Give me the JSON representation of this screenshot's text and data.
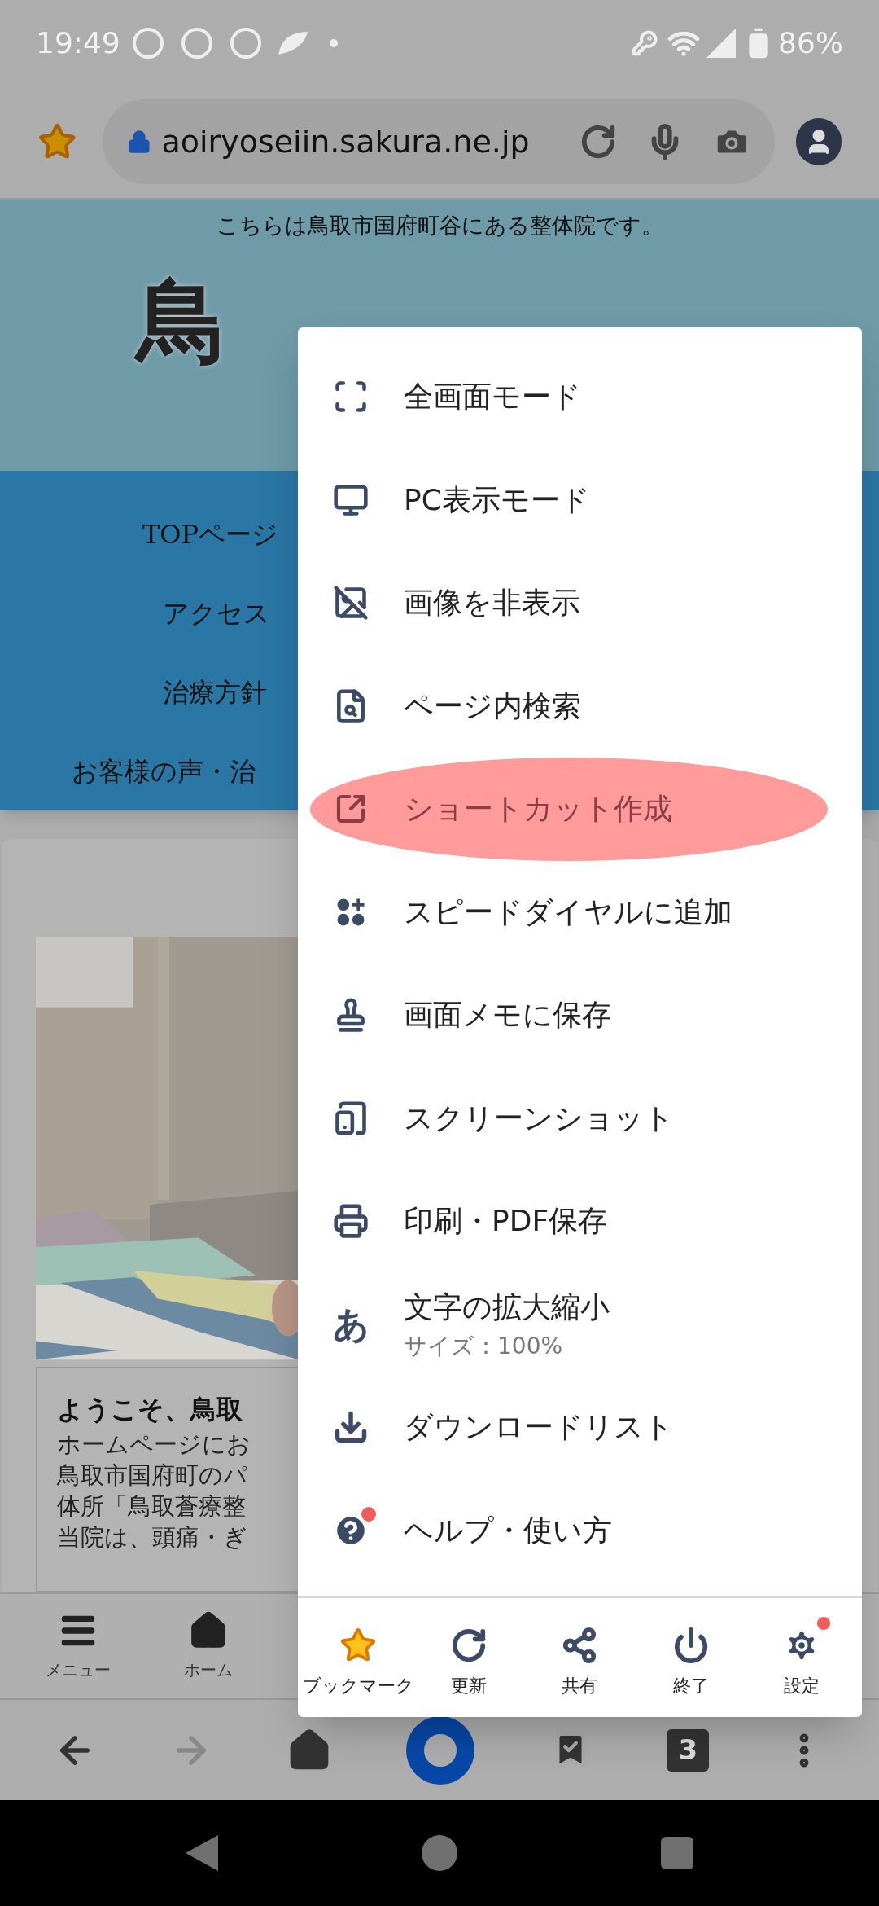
{
  "status_bar": {
    "time": "19:49",
    "battery": "86%"
  },
  "address_bar": {
    "url": "aoiryoseiin.sakura.ne.jp"
  },
  "page": {
    "tagline": "こちらは鳥取市国府町谷にある整体院です。",
    "logo_text": "鳥",
    "nav": [
      "TOPページ",
      "アクセス",
      "治療方針",
      "お客様の声・治"
    ],
    "welcome_title": "ようこそ、鳥取",
    "welcome_lines": [
      "ホームページにお",
      "鳥取市国府町のパ",
      "体所「鳥取蒼療整",
      "当院は、頭痛・ぎ"
    ],
    "site_nav": [
      "メニュー",
      "ホーム"
    ]
  },
  "menu": {
    "items": [
      {
        "label": "全画面モード",
        "highlighted": false,
        "badge": false
      },
      {
        "label": "PC表示モード",
        "highlighted": false,
        "badge": false
      },
      {
        "label": "画像を非表示",
        "highlighted": false,
        "badge": false
      },
      {
        "label": "ページ内検索",
        "highlighted": false,
        "badge": false
      },
      {
        "label": "ショートカット作成",
        "highlighted": true,
        "badge": false
      },
      {
        "label": "スピードダイヤルに追加",
        "highlighted": false,
        "badge": false
      },
      {
        "label": "画面メモに保存",
        "highlighted": false,
        "badge": false
      },
      {
        "label": "スクリーンショット",
        "highlighted": false,
        "badge": false
      },
      {
        "label": "印刷・PDF保存",
        "highlighted": false,
        "badge": false
      },
      {
        "label": "文字の拡大縮小",
        "sublabel": "サイズ：100%",
        "icon_char": "あ",
        "highlighted": false,
        "badge": false
      },
      {
        "label": "ダウンロードリスト",
        "highlighted": false,
        "badge": false
      },
      {
        "label": "ヘルプ・使い方",
        "highlighted": false,
        "badge": true
      }
    ],
    "actions": [
      {
        "label": "ブックマーク",
        "badge": false
      },
      {
        "label": "更新",
        "badge": false
      },
      {
        "label": "共有",
        "badge": false
      },
      {
        "label": "終了",
        "badge": false
      },
      {
        "label": "設定",
        "badge": true
      }
    ]
  },
  "toolbar": {
    "tab_count": "3"
  }
}
